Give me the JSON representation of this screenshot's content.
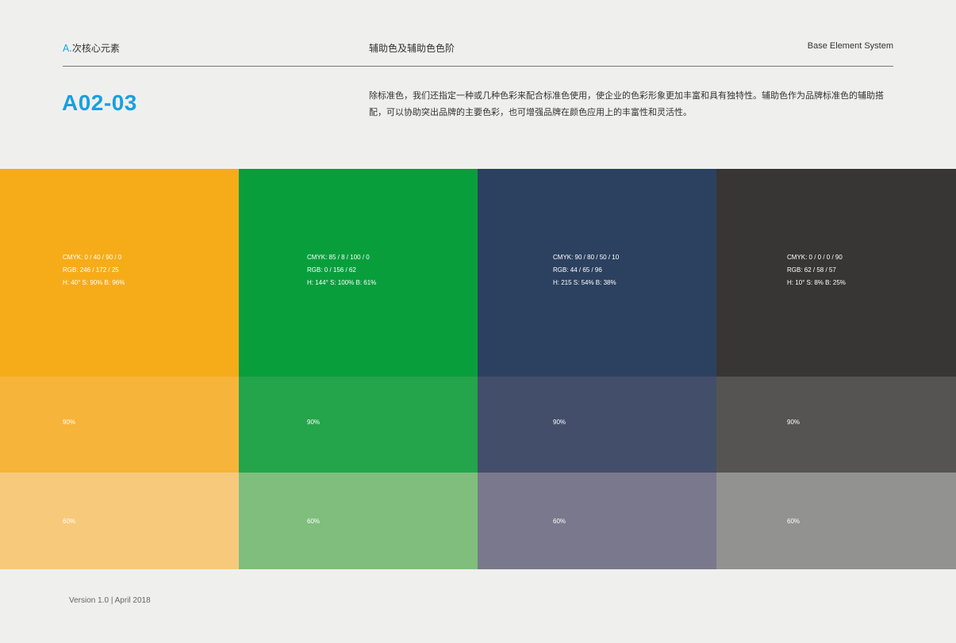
{
  "header": {
    "section_letter": "A.",
    "section_name": "次核心元素",
    "page_title": "辅助色及辅助色色阶",
    "system_name": "Base Element System"
  },
  "code": "A02-03",
  "description": "除标准色，我们还指定一种或几种色彩来配合标准色使用，使企业的色彩形象更加丰富和具有独特性。辅助色作为品牌标准色的辅助搭配，可以协助突出品牌的主要色彩，也可增强品牌在颜色应用上的丰富性和灵活性。",
  "colors": [
    {
      "cmyk": "CMYK:  0 / 40 / 90 / 0",
      "rgb": "RGB:  246 / 172 / 25",
      "hsb": "H:  40°  S:  90%  B:  96%",
      "hex_main": "#f6ac19",
      "hex_90": "#f7b43a",
      "hex_60": "#f7c97b",
      "tint_90": "90%",
      "tint_60": "60%"
    },
    {
      "cmyk": "CMYK:  85 / 8 / 100 / 0",
      "rgb": "RGB:  0 / 156 / 62",
      "hsb": "H:  144°  S:  100%  B:  61%",
      "hex_main": "#099e3c",
      "hex_90": "#24a44b",
      "hex_60": "#7fbe7c",
      "tint_90": "90%",
      "tint_60": "60%"
    },
    {
      "cmyk": "CMYK:  90 / 80 / 50 / 10",
      "rgb": "RGB:  44 / 65 / 96",
      "hsb": "H:  215  S:  54%  B:  38%",
      "hex_main": "#2c4160",
      "hex_90": "#434e6b",
      "hex_60": "#7a788c",
      "tint_90": "90%",
      "tint_60": "60%"
    },
    {
      "cmyk": "CMYK:  0 / 0 / 0 / 90",
      "rgb": "RGB:  62 / 58 / 57",
      "hsb": "H:  10°  S:  8%  B:  25%",
      "hex_main": "#373634",
      "hex_90": "#555452",
      "hex_60": "#929291",
      "tint_90": "90%",
      "tint_60": "60%"
    }
  ],
  "footer": "Version 1.0  |  April 2018"
}
